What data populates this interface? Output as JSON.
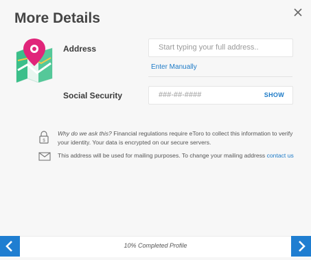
{
  "dialog": {
    "title": "More Details",
    "close_icon": "close-icon"
  },
  "address": {
    "label": "Address",
    "placeholder": "Start typing your full address..",
    "enter_manually": "Enter Manually",
    "icon": "map-pin-icon"
  },
  "ssn": {
    "label": "Social Security",
    "placeholder": "###-##-####",
    "show_label": "SHOW"
  },
  "info": {
    "why_question": "Why do we ask this?",
    "why_text": " Financial regulations require eToro to collect this information to verify your identity. Your data is encrypted on our secure servers.",
    "mail_text": "This address will be used for mailing purposes. To change your mailing address ",
    "contact_link": "contact us",
    "lock_icon": "lock-icon",
    "mail_icon": "envelope-icon"
  },
  "footer": {
    "progress": "10% Completed Profile",
    "progress_value": 0.1,
    "prev_icon": "chevron-left-icon",
    "next_icon": "chevron-right-icon"
  },
  "colors": {
    "accent": "#1f7ed1",
    "link": "#1c7ac7",
    "pin": "#e0257a",
    "map_green": "#3bbf8a"
  }
}
